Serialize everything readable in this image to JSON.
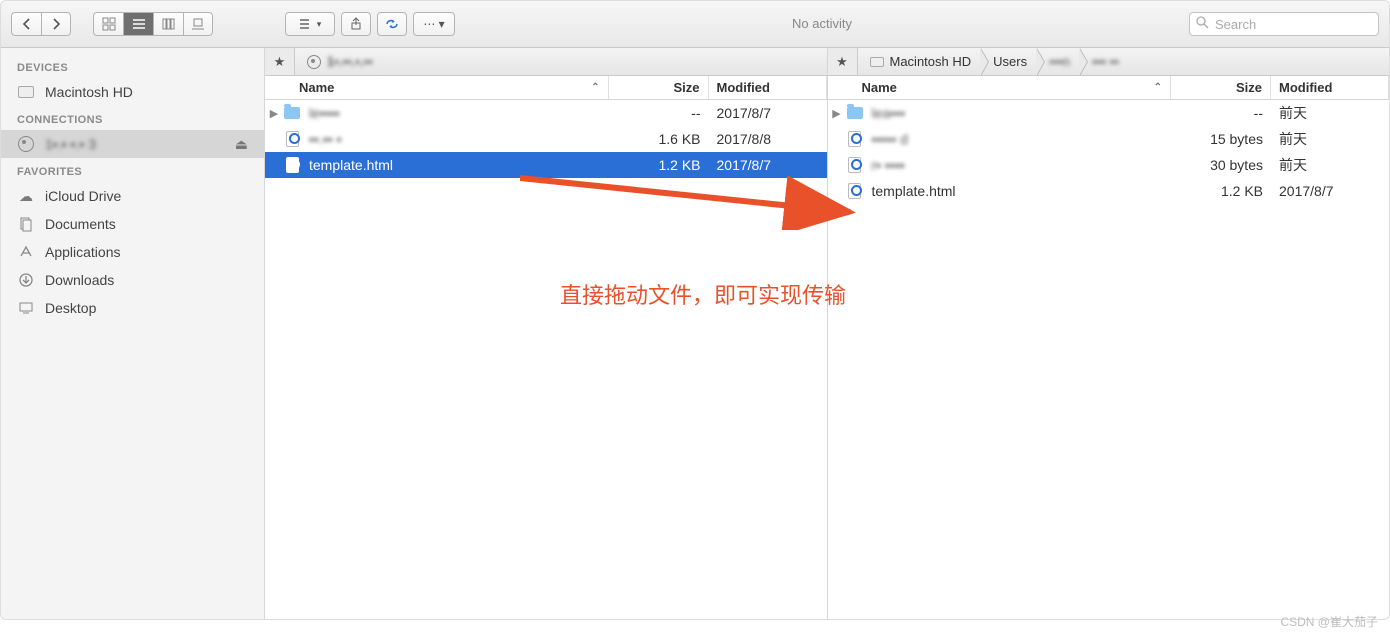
{
  "toolbar": {
    "activity": "No activity",
    "search_placeholder": "Search"
  },
  "sidebar": {
    "sections": {
      "devices": "DEVICES",
      "connections": "CONNECTIONS",
      "favorites": "FAVORITES"
    },
    "devices": [
      {
        "label": "Macintosh HD"
      }
    ],
    "connections": [
      {
        "label": "1▪.▪ ▪.▪ 3"
      }
    ],
    "favorites": [
      {
        "label": "iCloud Drive"
      },
      {
        "label": "Documents"
      },
      {
        "label": "Applications"
      },
      {
        "label": "Downloads"
      },
      {
        "label": "Desktop"
      }
    ]
  },
  "columns": {
    "name": "Name",
    "size": "Size",
    "modified": "Modified"
  },
  "left_pane": {
    "path": [
      {
        "label": "1▪.▪▪.▪.▪▪"
      }
    ],
    "rows": [
      {
        "type": "folder",
        "expandable": true,
        "name": "le▪▪▪▪",
        "size": "--",
        "modified": "2017/8/7",
        "selected": false
      },
      {
        "type": "file",
        "expandable": false,
        "name": "▪▪.▪▪ ▪",
        "size": "1.6 KB",
        "modified": "2017/8/8",
        "selected": false
      },
      {
        "type": "file",
        "expandable": false,
        "name": "template.html",
        "size": "1.2 KB",
        "modified": "2017/8/7",
        "selected": true
      }
    ]
  },
  "right_pane": {
    "path": [
      {
        "label": "Macintosh HD"
      },
      {
        "label": "Users"
      },
      {
        "label": "▪▪▪n"
      },
      {
        "label": "▪▪▪ ▪▪"
      }
    ],
    "rows": [
      {
        "type": "folder",
        "expandable": true,
        "name": "lea▪▪▪",
        "size": "--",
        "modified": "前天",
        "selected": false
      },
      {
        "type": "file",
        "expandable": false,
        "name": "▪▪▪▪▪  d",
        "size": "15 bytes",
        "modified": "前天",
        "selected": false
      },
      {
        "type": "file",
        "expandable": false,
        "name": "r▪ ▪▪▪▪",
        "size": "30 bytes",
        "modified": "前天",
        "selected": false
      },
      {
        "type": "file",
        "expandable": false,
        "name": "template.html",
        "size": "1.2 KB",
        "modified": "2017/8/7",
        "selected": false
      }
    ]
  },
  "annotation_text": "直接拖动文件，即可实现传输",
  "watermark": "CSDN @崔大茄子"
}
